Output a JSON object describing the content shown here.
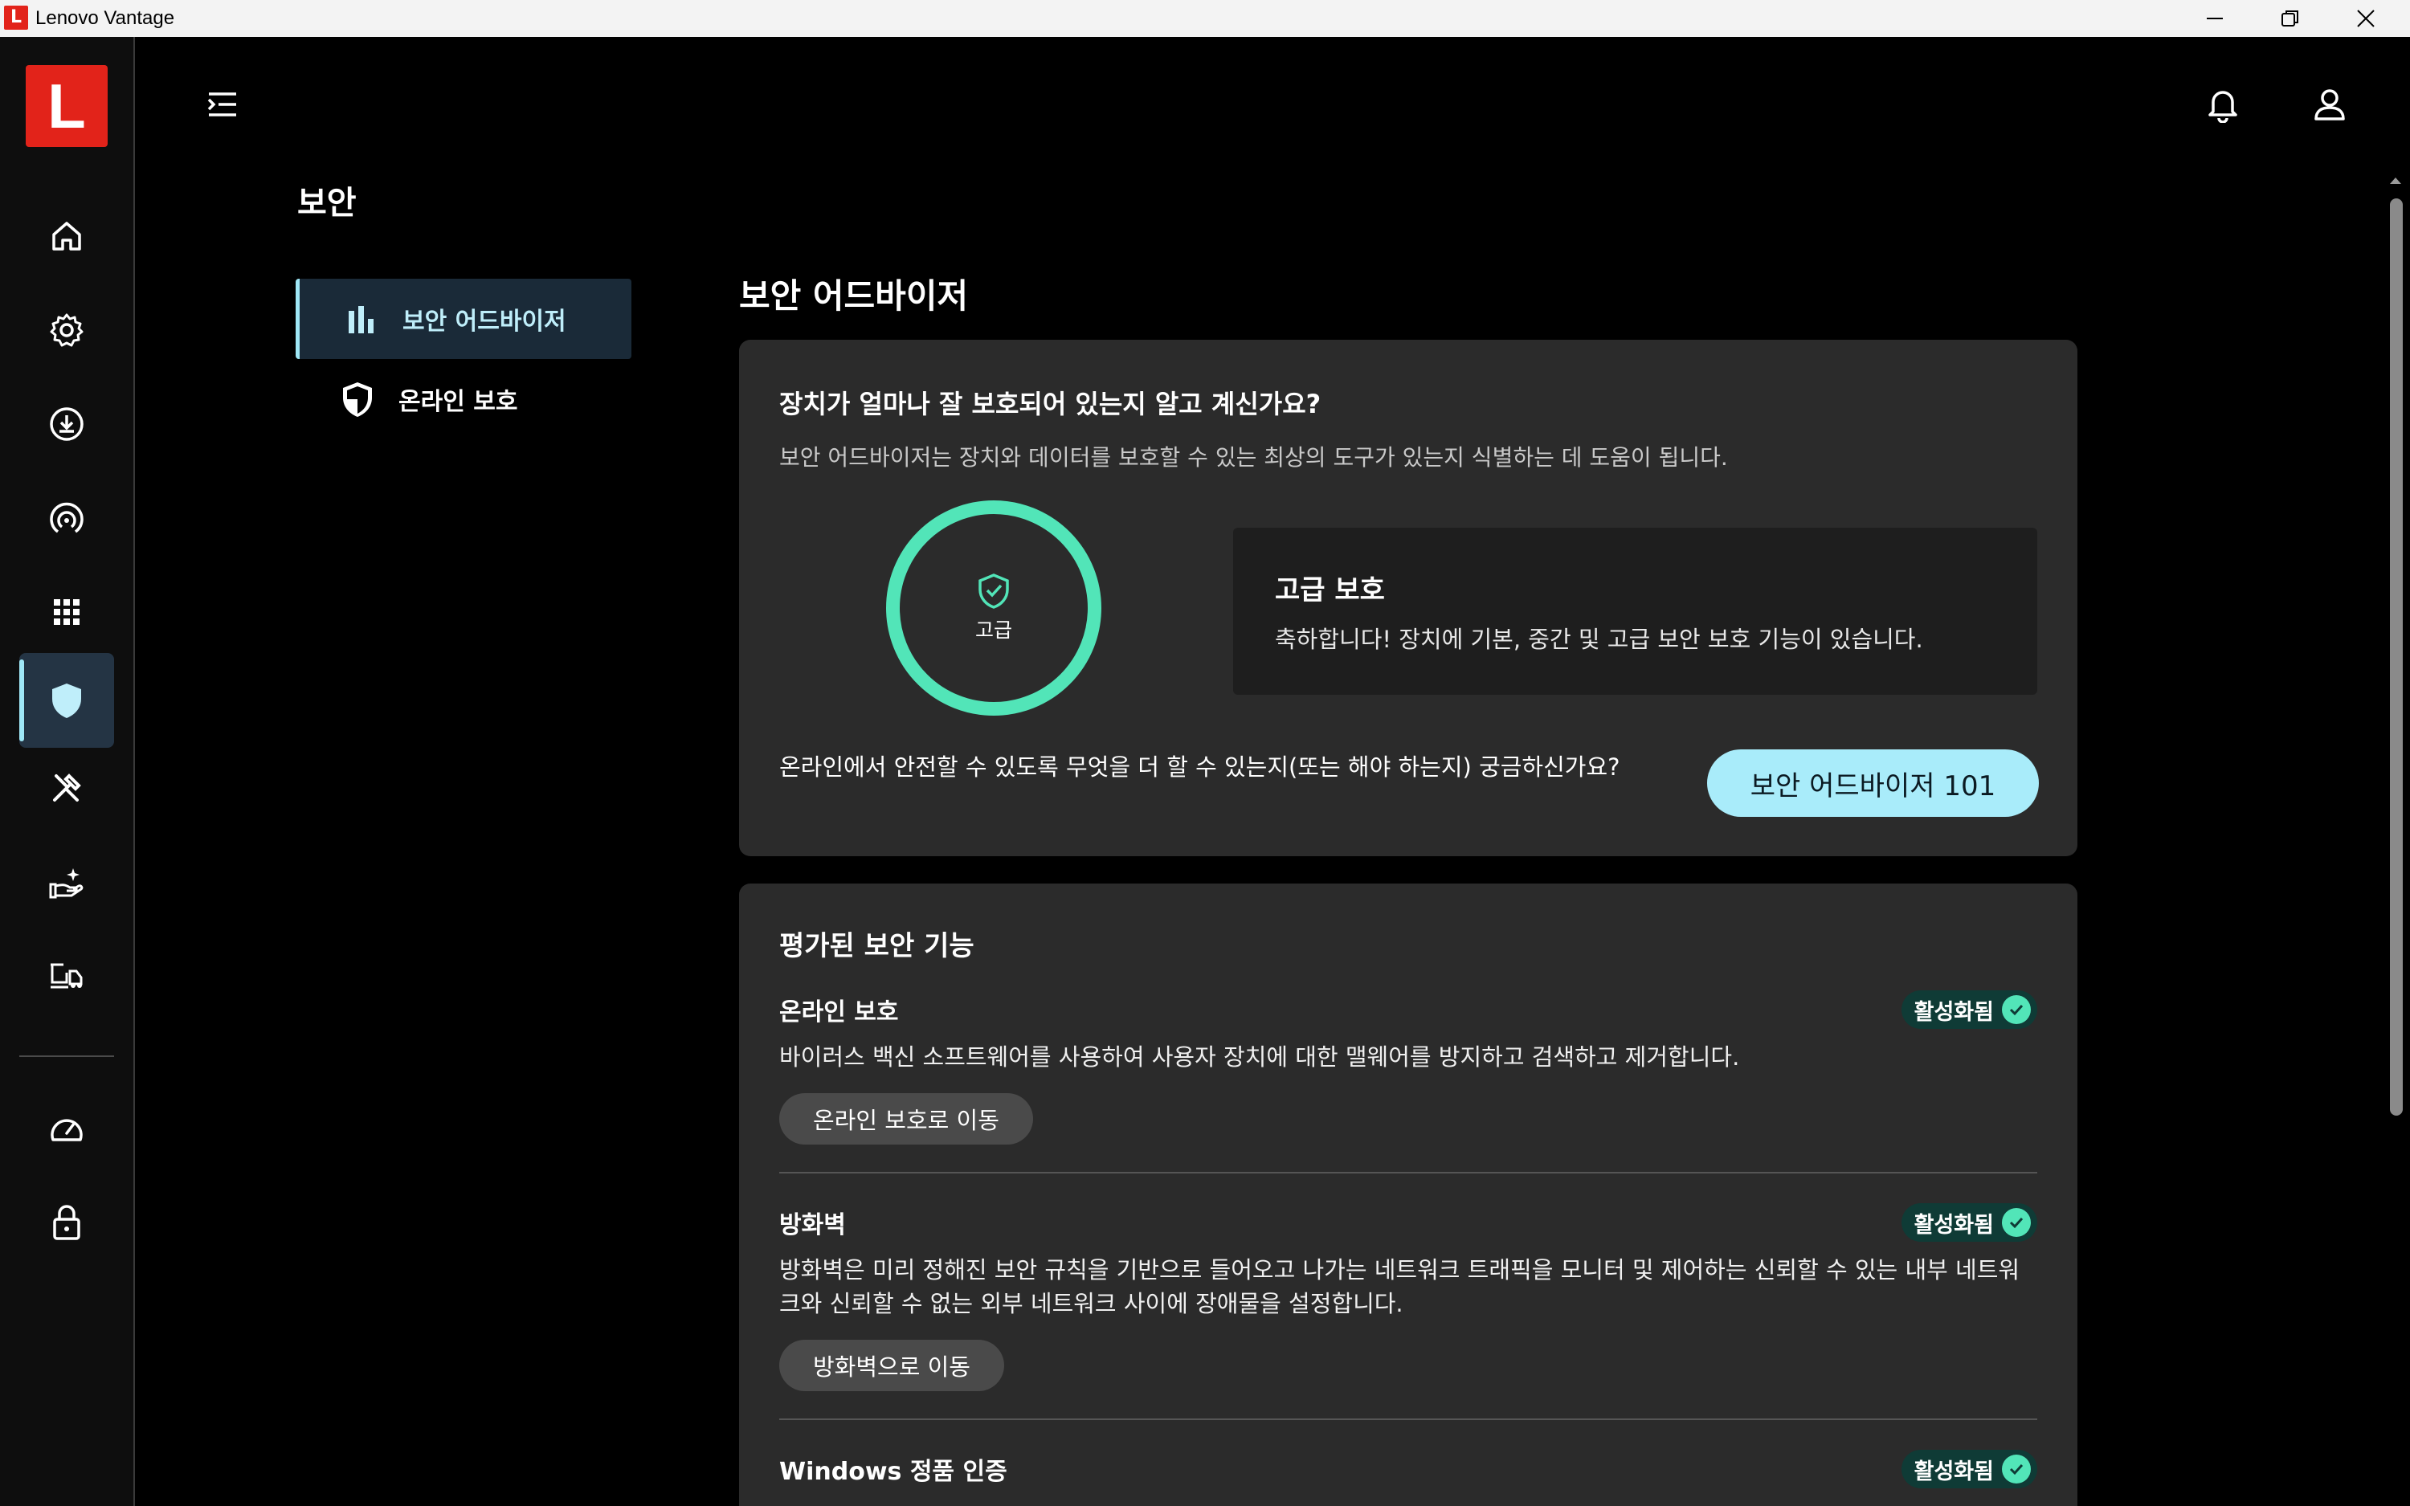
{
  "window": {
    "title": "Lenovo Vantage",
    "app_icon_letter": "L"
  },
  "rail": {
    "logo_letter": "L",
    "items": [
      {
        "name": "home",
        "icon": "home-icon"
      },
      {
        "name": "settings",
        "icon": "gear-icon"
      },
      {
        "name": "updates",
        "icon": "download-icon"
      },
      {
        "name": "power",
        "icon": "gauge-icon"
      },
      {
        "name": "apps",
        "icon": "grid-icon"
      },
      {
        "name": "security",
        "icon": "shield-icon",
        "active": true
      },
      {
        "name": "tools",
        "icon": "tools-icon"
      },
      {
        "name": "services",
        "icon": "hand-sparkle-icon"
      },
      {
        "name": "support",
        "icon": "device-support-icon"
      },
      {
        "name": "performance",
        "icon": "speedometer-icon"
      },
      {
        "name": "lock",
        "icon": "lock-icon"
      }
    ]
  },
  "page": {
    "title": "보안"
  },
  "subnav": {
    "items": [
      {
        "label": "보안 어드바이저",
        "icon": "bar-chart-icon",
        "active": true
      },
      {
        "label": "온라인 보호",
        "icon": "shield-half-icon",
        "active": false
      }
    ]
  },
  "advisor": {
    "section_title": "보안 어드바이저",
    "question": "장치가 얼마나 잘 보호되어 있는지 알고 계신가요?",
    "description": "보안 어드바이저는 장치와 데이터를 보호할 수 있는 최상의 도구가 있는지 식별하는 데 도움이 됩니다.",
    "ring_label": "고급",
    "level_title": "고급 보호",
    "level_desc": "축하합니다! 장치에 기본, 중간 및 고급 보안 보호 기능이 있습니다.",
    "more_question": "온라인에서 안전할 수 있도록 무엇을 더 할 수 있는지(또는 해야 하는지) 궁금하신가요?",
    "more_button": "보안 어드바이저 101",
    "accent_color": "#52e5b8"
  },
  "features": {
    "title": "평가된 보안 기능",
    "items": [
      {
        "title": "온라인 보호",
        "status": "활성화됨",
        "desc": "바이러스 백신 소프트웨어를 사용하여 사용자 장치에 대한 맬웨어를 방지하고 검색하고 제거합니다.",
        "button": "온라인 보호로 이동"
      },
      {
        "title": "방화벽",
        "status": "활성화됨",
        "desc": "방화벽은 미리 정해진 보안 규칙을 기반으로 들어오고 나가는 네트워크 트래픽을 모니터 및 제어하는 신뢰할 수 있는 내부 네트워크와 신뢰할 수 없는 외부 네트워크 사이에 장애물을 설정합니다.",
        "button": "방화벽으로 이동"
      },
      {
        "title": "Windows 정품 인증",
        "status": "활성화됨"
      }
    ]
  }
}
